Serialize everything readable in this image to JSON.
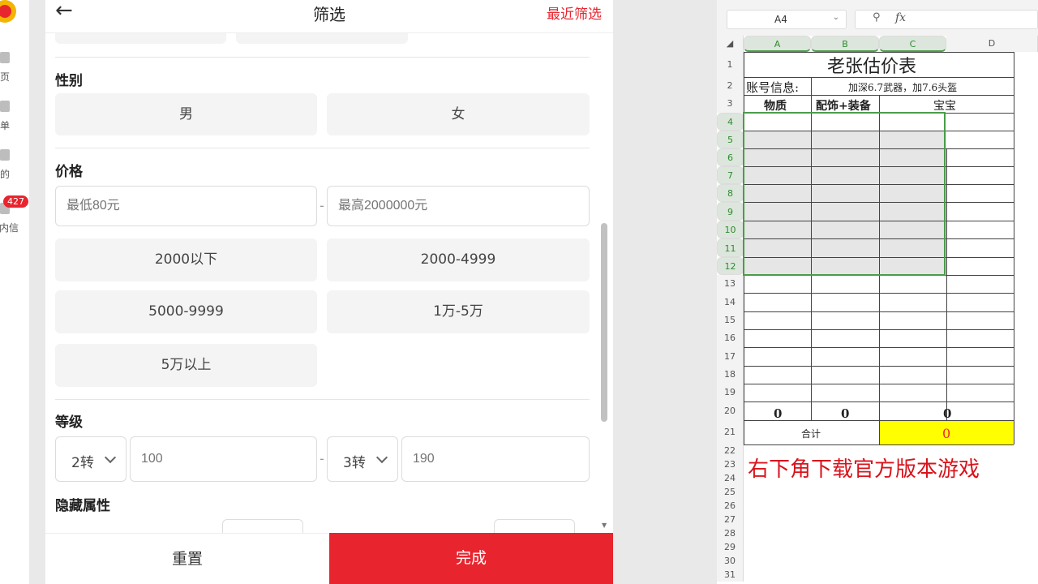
{
  "app_nav": {
    "items": [
      {
        "label": "首页"
      },
      {
        "label": "订单"
      },
      {
        "label": "我的"
      },
      {
        "label": "站内信"
      }
    ],
    "badge": "427"
  },
  "filter": {
    "title": "筛选",
    "recent_label": "最近筛选",
    "gender": {
      "title": "性别",
      "options": [
        "男",
        "女"
      ]
    },
    "price": {
      "title": "价格",
      "min_placeholder": "最低80元",
      "max_placeholder": "最高2000000元",
      "dash": "-",
      "ranges": [
        "2000以下",
        "2000-4999",
        "5000-9999",
        "1万-5万",
        "5万以上"
      ]
    },
    "level": {
      "title": "等级",
      "min_select": "2转",
      "min_placeholder": "100",
      "dash": "-",
      "max_select": "3转",
      "max_placeholder": "190"
    },
    "hidden_attr": {
      "title": "隐藏属性"
    },
    "reset_label": "重置",
    "done_label": "完成"
  },
  "sheet": {
    "name_box": "A4",
    "fx_label": "fx",
    "columns": [
      "A",
      "B",
      "C",
      "D"
    ],
    "rows": [
      "1",
      "2",
      "3",
      "4",
      "5",
      "6",
      "7",
      "8",
      "9",
      "10",
      "11",
      "12",
      "13",
      "14",
      "15",
      "16",
      "17",
      "18",
      "19",
      "20",
      "21",
      "22",
      "23",
      "24",
      "25",
      "26",
      "27",
      "28",
      "29",
      "30",
      "31"
    ],
    "title": "老张估价表",
    "account_label": "账号信息:",
    "account_value": "加深6.7武器，加7.6头盔",
    "headers": [
      "物质",
      "配饰+装备",
      "宝宝"
    ],
    "sum_values": [
      "0",
      "0",
      "0"
    ],
    "total_label": "合计",
    "total_value": "0",
    "ad_text": "右下角下载官方版本游戏"
  }
}
